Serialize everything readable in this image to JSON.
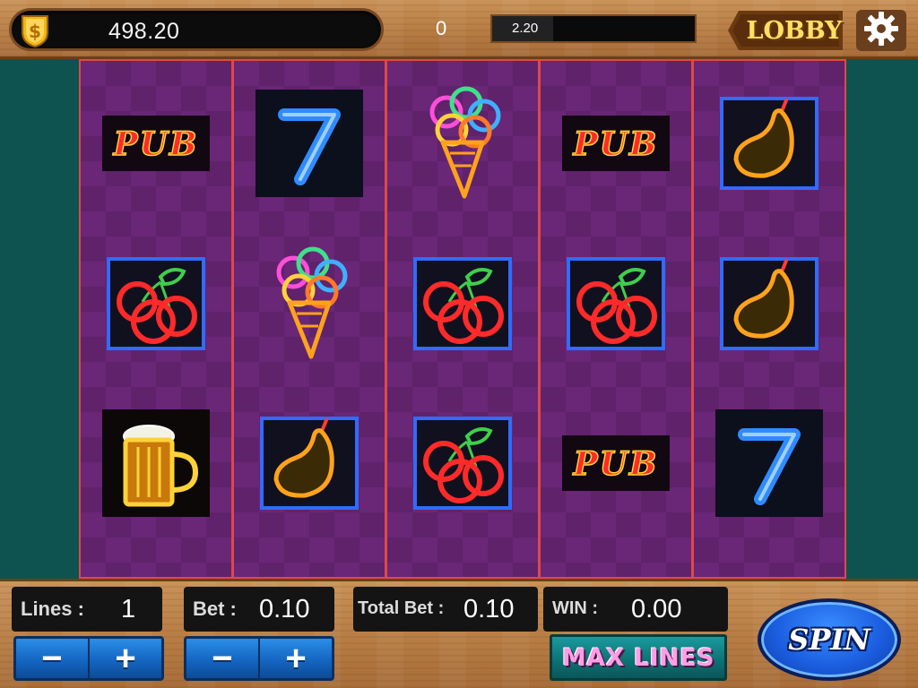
{
  "top_bar": {
    "coins": "498.20",
    "center_value": "0",
    "xp_value": "2.20",
    "xp_fraction": 0.3,
    "lobby_label": "LOBBY"
  },
  "reels": [
    [
      "pub-sign",
      "cherries",
      "beer-mug"
    ],
    [
      "neon-seven",
      "ice-cream",
      "pear"
    ],
    [
      "ice-cream",
      "cherries",
      "cherries"
    ],
    [
      "pub-sign",
      "cherries",
      "pub-sign"
    ],
    [
      "pear",
      "pear",
      "neon-seven"
    ]
  ],
  "symbol_text": {
    "pub": "PUB"
  },
  "controls": {
    "lines_label": "Lines :",
    "lines_value": "1",
    "bet_label": "Bet :",
    "bet_value": "0.10",
    "total_bet_label": "Total Bet :",
    "total_bet_value": "0.10",
    "win_label": "WIN :",
    "win_value": "0.00",
    "minus": "−",
    "plus": "+",
    "max_lines_label": "MAX LINES",
    "spin_label": "SPIN"
  },
  "colors": {
    "reel_purple": "#6a2677",
    "reel_border": "#e04848",
    "neon_red": "#ff2a2a",
    "neon_blue": "#2f8cff",
    "neon_orange": "#ffa21c",
    "button_blue": "#1466c2",
    "max_lines_teal": "#0d7073"
  }
}
